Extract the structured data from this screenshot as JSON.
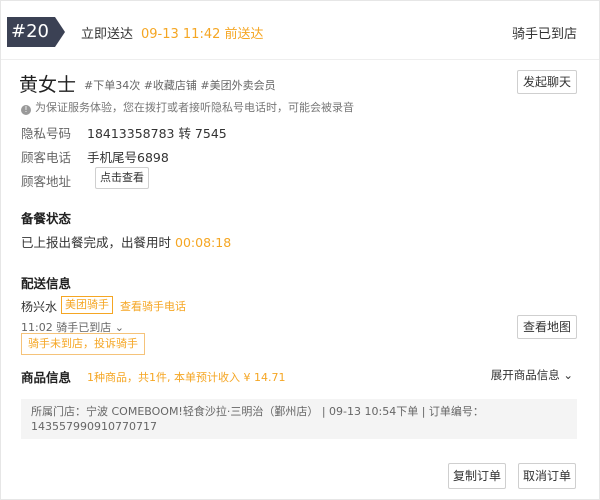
{
  "header": {
    "order_no": "#20",
    "delivery_type": "立即送达",
    "delivery_time": "09-13 11:42 前送达",
    "rider_status": "骑手已到店"
  },
  "customer": {
    "name": "黄女士",
    "tags": "#下单34次 #收藏店铺 #美团外卖会员",
    "chat_button": "发起聊天",
    "notice": "为保证服务体验，您在拨打或者接听隐私号电话时，可能会被录音",
    "rows": [
      {
        "label": "隐私号码",
        "value": "18413358783 转 7545"
      },
      {
        "label": "顾客电话",
        "value": "手机尾号6898"
      },
      {
        "label": "顾客地址",
        "value": ""
      }
    ],
    "address_button": "点击查看"
  },
  "prep": {
    "title": "备餐状态",
    "text": "已上报出餐完成，出餐用时",
    "duration": "00:08:18"
  },
  "delivery": {
    "title": "配送信息",
    "rider_name": "杨兴水",
    "rider_badge": "美团骑手",
    "rider_phone_link": "查看骑手电话",
    "arrive_text": "11:02 骑手已到店 ⌄",
    "complain_button": "骑手未到店，投诉骑手",
    "map_button": "查看地图"
  },
  "goods": {
    "title": "商品信息",
    "summary": "1种商品，共1件, 本单预计收入 ¥ 14.71",
    "expand": "展开商品信息 ⌄"
  },
  "meta": {
    "line1": "所属门店：宁波 COMEBOOM!轻食沙拉·三明治（鄞州店） |  09-13 10:54下单  |  订单编号：",
    "line2": "143557990910770717"
  },
  "actions": {
    "copy": "复制订单",
    "cancel": "取消订单"
  },
  "colors": {
    "accent": "#f5a623",
    "badge_bg": "#3b4154"
  }
}
